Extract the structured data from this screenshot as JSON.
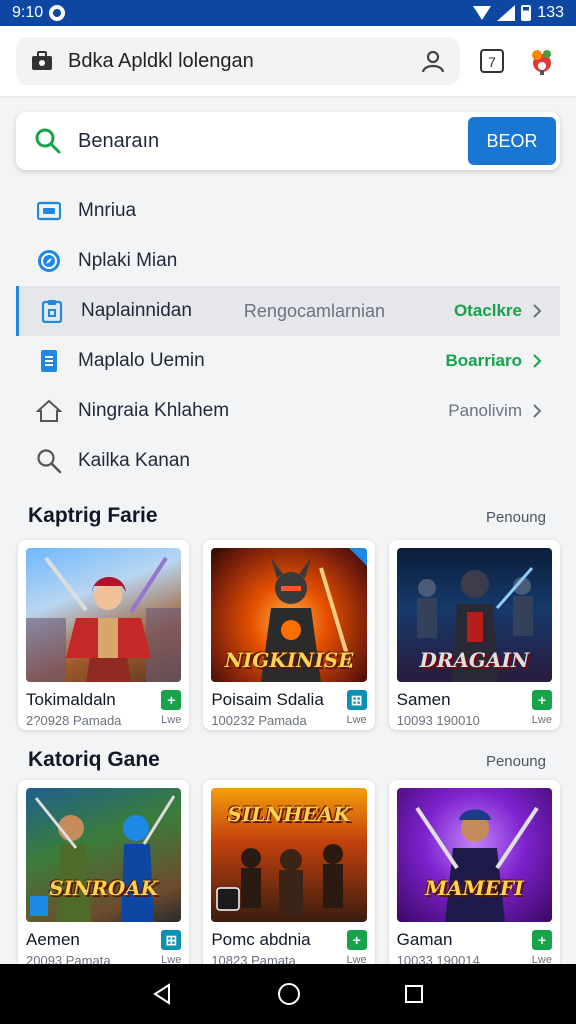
{
  "status_bar": {
    "time": "9:10",
    "battery": "133"
  },
  "app_bar": {
    "title": "Bdka Apldkl lolengan",
    "notification_count": "7"
  },
  "search": {
    "query": "Benaraın",
    "button_label": "BEOR"
  },
  "menu": [
    {
      "label": "Mnriua",
      "icon": "wallet-icon",
      "sub": "",
      "right": ""
    },
    {
      "label": "Nplaki Mian",
      "icon": "compass-icon",
      "sub": "",
      "right": ""
    },
    {
      "label": "Naplainnidan",
      "icon": "clipboard-icon",
      "sub": "Rengocamlarnian",
      "right": "Otaclkre",
      "active": true,
      "right_color": "green"
    },
    {
      "label": "Maplalo Uemin",
      "icon": "document-icon",
      "sub": "",
      "right": "Boarriaro",
      "right_color": "green"
    },
    {
      "label": "Ningraia Khlahem",
      "icon": "home-icon",
      "sub": "",
      "right": "Panolivim"
    },
    {
      "label": "Kailka Kanan",
      "icon": "search-icon",
      "sub": "",
      "right": ""
    }
  ],
  "section1": {
    "title": "Kaptrig Farie",
    "link": "Penoung",
    "cards": [
      {
        "title": "Tokimaldaln",
        "meta": "2?0928 Pamada",
        "badge": "+",
        "badge_color": "green",
        "live": "Lwe",
        "art": ""
      },
      {
        "title": "Poisaim Sdalia",
        "meta": "100232 Pamada",
        "badge": "⊞",
        "badge_color": "teal",
        "live": "Lwe",
        "art": "NIGKINISE"
      },
      {
        "title": "Samen",
        "meta": "10093 190010",
        "badge": "+",
        "badge_color": "green",
        "live": "Lwe",
        "art": "DRAGAIN"
      }
    ]
  },
  "section2": {
    "title": "Katoriq Gane",
    "link": "Penoung",
    "cards": [
      {
        "title": "Aemen",
        "meta": "20093 Pamata",
        "badge": "⊞",
        "badge_color": "teal",
        "live": "Lwe",
        "art": "SINROAK"
      },
      {
        "title": "Pomc abdnia",
        "meta": "10823 Pamata",
        "badge": "+",
        "badge_color": "green",
        "live": "Lwe",
        "art": "SILNHEAK"
      },
      {
        "title": "Gaman",
        "meta": "10033 190014",
        "badge": "+",
        "badge_color": "green",
        "live": "Lwe",
        "art": "MAMEFI"
      }
    ]
  },
  "colors": {
    "status_bar": "#0d47a1",
    "primary": "#1976d2",
    "accent_green": "#16a34a"
  }
}
